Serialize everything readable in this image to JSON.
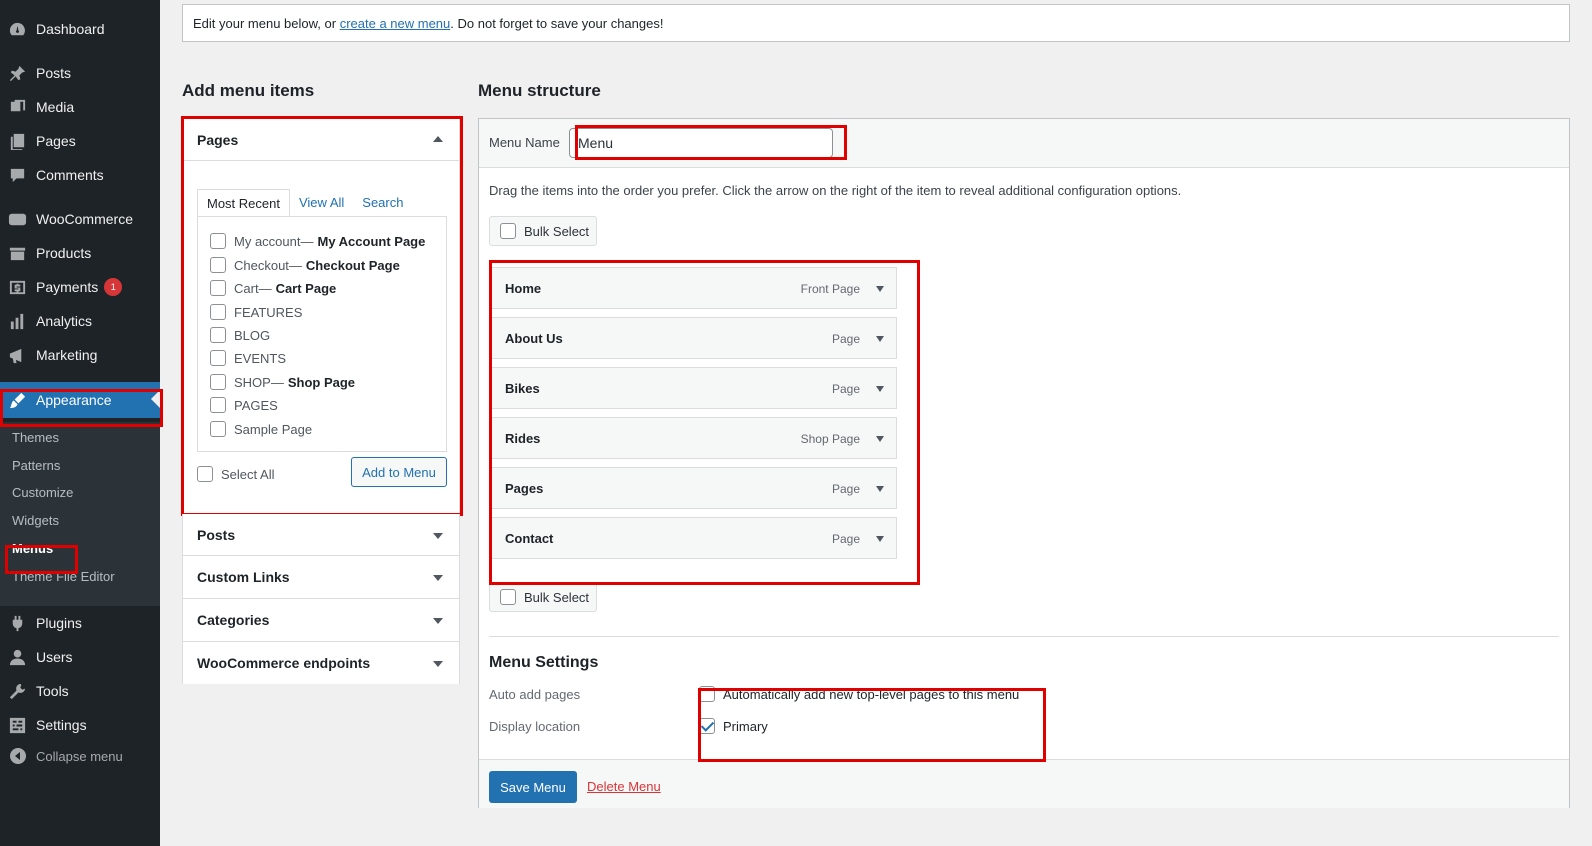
{
  "sidebar": {
    "items": [
      {
        "label": "Dashboard",
        "icon": "dashboard-icon"
      },
      {
        "label": "Posts",
        "icon": "pin-icon"
      },
      {
        "label": "Media",
        "icon": "media-icon"
      },
      {
        "label": "Pages",
        "icon": "pages-icon"
      },
      {
        "label": "Comments",
        "icon": "comments-icon"
      },
      {
        "label": "WooCommerce",
        "icon": "woocommerce-icon"
      },
      {
        "label": "Products",
        "icon": "products-icon"
      },
      {
        "label": "Payments",
        "icon": "payments-icon",
        "badge": "1"
      },
      {
        "label": "Analytics",
        "icon": "analytics-icon"
      },
      {
        "label": "Marketing",
        "icon": "marketing-icon"
      },
      {
        "label": "Appearance",
        "icon": "brush-icon"
      },
      {
        "label": "Plugins",
        "icon": "plugins-icon"
      },
      {
        "label": "Users",
        "icon": "users-icon"
      },
      {
        "label": "Tools",
        "icon": "tools-icon"
      },
      {
        "label": "Settings",
        "icon": "settings-icon"
      }
    ],
    "submenu": [
      "Themes",
      "Patterns",
      "Customize",
      "Widgets",
      "Menus",
      "Theme File Editor"
    ],
    "collapse_label": "Collapse menu"
  },
  "notice": {
    "before": "Edit your menu below, or ",
    "link": "create a new menu",
    "after": ". Do not forget to save your changes!"
  },
  "add_items": {
    "heading": "Add menu items",
    "pages_title": "Pages",
    "tabs": [
      "Most Recent",
      "View All",
      "Search"
    ],
    "pages": [
      {
        "name": "My account",
        "sep": " —",
        "tag": "My Account Page"
      },
      {
        "name": "Checkout",
        "sep": " —",
        "tag": "Checkout Page"
      },
      {
        "name": "Cart",
        "sep": " —",
        "tag": "Cart Page"
      },
      {
        "name": "FEATURES",
        "sep": "",
        "tag": ""
      },
      {
        "name": "BLOG",
        "sep": "",
        "tag": ""
      },
      {
        "name": "EVENTS",
        "sep": "",
        "tag": ""
      },
      {
        "name": "SHOP",
        "sep": " —",
        "tag": "Shop Page"
      },
      {
        "name": "PAGES",
        "sep": "",
        "tag": ""
      },
      {
        "name": "Sample Page",
        "sep": "",
        "tag": ""
      }
    ],
    "select_all": "Select All",
    "add_button": "Add to Menu",
    "sections": [
      "Posts",
      "Custom Links",
      "Categories",
      "WooCommerce endpoints"
    ]
  },
  "structure": {
    "heading": "Menu structure",
    "menu_name_label": "Menu Name",
    "menu_name_value": "Menu",
    "drag_hint": "Drag the items into the order you prefer. Click the arrow on the right of the item to reveal additional configuration options.",
    "bulk_select": "Bulk Select",
    "items": [
      {
        "title": "Home",
        "type": "Front Page"
      },
      {
        "title": "About Us",
        "type": "Page"
      },
      {
        "title": "Bikes",
        "type": "Page"
      },
      {
        "title": "Rides",
        "type": "Shop Page"
      },
      {
        "title": "Pages",
        "type": "Page"
      },
      {
        "title": "Contact",
        "type": "Page"
      }
    ],
    "settings_title": "Menu Settings",
    "auto_add_label": "Auto add pages",
    "auto_add_option": "Automatically add new top-level pages to this menu",
    "auto_add_checked": false,
    "display_location_label": "Display location",
    "display_location_option": "Primary",
    "display_location_checked": true,
    "save_button": "Save Menu",
    "delete_link": "Delete Menu"
  },
  "colors": {
    "accent": "#2271b1",
    "sidebar_bg": "#1d2327",
    "highlight_box": "#e00000",
    "danger": "#d63638"
  }
}
